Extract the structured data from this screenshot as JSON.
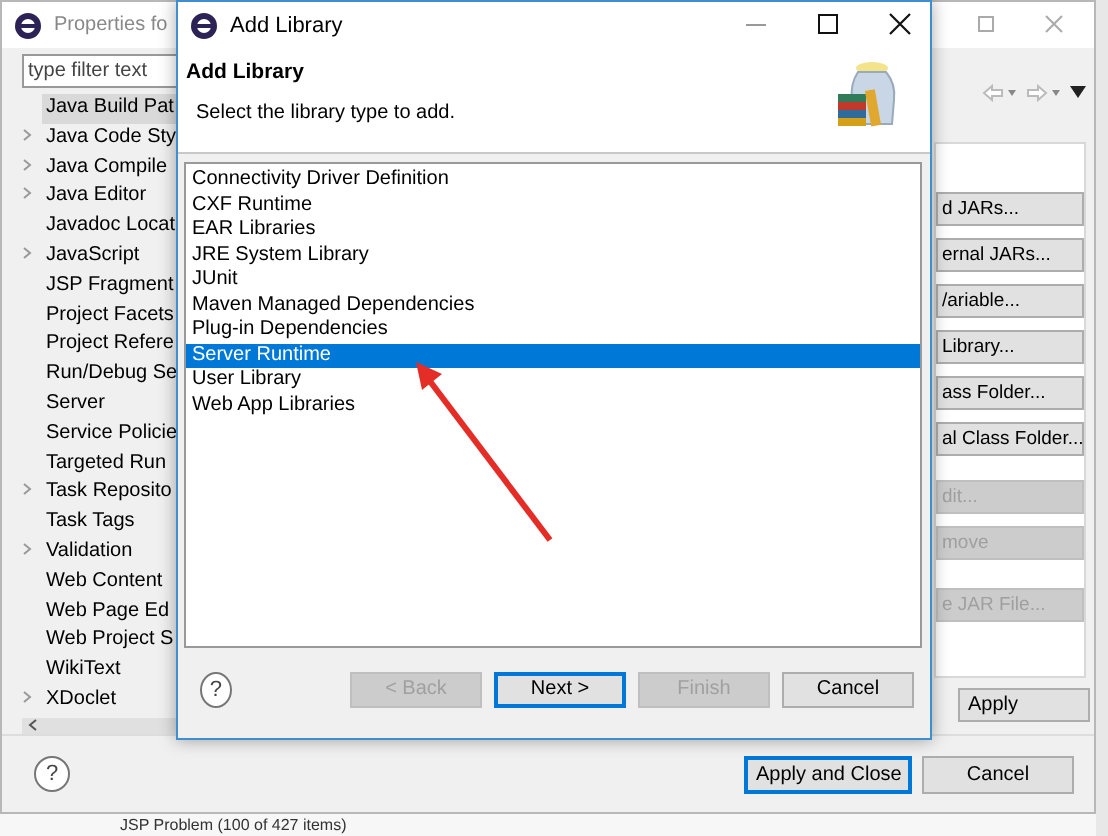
{
  "background_window": {
    "title": "Properties fo",
    "filter": {
      "placeholder": "type filter text"
    },
    "tree": [
      {
        "label": "Java Build Pat",
        "expandable": false,
        "selected": true
      },
      {
        "label": "Java Code Sty",
        "expandable": true,
        "selected": false
      },
      {
        "label": "Java Compile",
        "expandable": true,
        "selected": false
      },
      {
        "label": "Java Editor",
        "expandable": true,
        "selected": false
      },
      {
        "label": "Javadoc Locat",
        "expandable": false,
        "selected": false
      },
      {
        "label": "JavaScript",
        "expandable": true,
        "selected": false
      },
      {
        "label": "JSP Fragment",
        "expandable": false,
        "selected": false
      },
      {
        "label": "Project Facets",
        "expandable": false,
        "selected": false
      },
      {
        "label": "Project Refere",
        "expandable": false,
        "selected": false
      },
      {
        "label": "Run/Debug Se",
        "expandable": false,
        "selected": false
      },
      {
        "label": "Server",
        "expandable": false,
        "selected": false
      },
      {
        "label": "Service Policie",
        "expandable": false,
        "selected": false
      },
      {
        "label": "Targeted Run",
        "expandable": false,
        "selected": false
      },
      {
        "label": "Task Reposito",
        "expandable": true,
        "selected": false
      },
      {
        "label": "Task Tags",
        "expandable": false,
        "selected": false
      },
      {
        "label": "Validation",
        "expandable": true,
        "selected": false
      },
      {
        "label": "Web Content",
        "expandable": false,
        "selected": false
      },
      {
        "label": "Web Page Ed",
        "expandable": false,
        "selected": false
      },
      {
        "label": "Web Project S",
        "expandable": false,
        "selected": false
      },
      {
        "label": "WikiText",
        "expandable": false,
        "selected": false
      },
      {
        "label": "XDoclet",
        "expandable": true,
        "selected": false
      }
    ],
    "side_buttons": [
      {
        "label": "d JARs...",
        "disabled": false
      },
      {
        "label": "ernal JARs...",
        "disabled": false
      },
      {
        "label": "/ariable...",
        "disabled": false
      },
      {
        "label": "Library...",
        "disabled": false
      },
      {
        "label": "ass Folder...",
        "disabled": false
      },
      {
        "label": "al Class Folder...",
        "disabled": false
      },
      {
        "label": "dit...",
        "disabled": true
      },
      {
        "label": "move",
        "disabled": true
      },
      {
        "label": "e JAR File...",
        "disabled": true
      }
    ],
    "apply_button": "Apply",
    "help_icon": "?",
    "bottom_buttons": [
      {
        "label": "Apply and Close",
        "default": true
      },
      {
        "label": "Cancel",
        "default": false
      }
    ],
    "status_text": "JSP Problem (100 of 427 items)"
  },
  "dialog": {
    "title": "Add Library",
    "heading": "Add Library",
    "description": "Select the library type to add.",
    "items": [
      {
        "label": "Connectivity Driver Definition",
        "selected": false
      },
      {
        "label": "CXF Runtime",
        "selected": false
      },
      {
        "label": "EAR Libraries",
        "selected": false
      },
      {
        "label": "JRE System Library",
        "selected": false
      },
      {
        "label": "JUnit",
        "selected": false
      },
      {
        "label": "Maven Managed Dependencies",
        "selected": false
      },
      {
        "label": "Plug-in Dependencies",
        "selected": false
      },
      {
        "label": "Server Runtime",
        "selected": true
      },
      {
        "label": "User Library",
        "selected": false
      },
      {
        "label": "Web App Libraries",
        "selected": false
      }
    ],
    "help_icon": "?",
    "buttons": [
      {
        "label": "< Back",
        "disabled": true,
        "default": false
      },
      {
        "label": "Next >",
        "disabled": false,
        "default": true
      },
      {
        "label": "Finish",
        "disabled": true,
        "default": false
      },
      {
        "label": "Cancel",
        "disabled": false,
        "default": false
      }
    ]
  }
}
